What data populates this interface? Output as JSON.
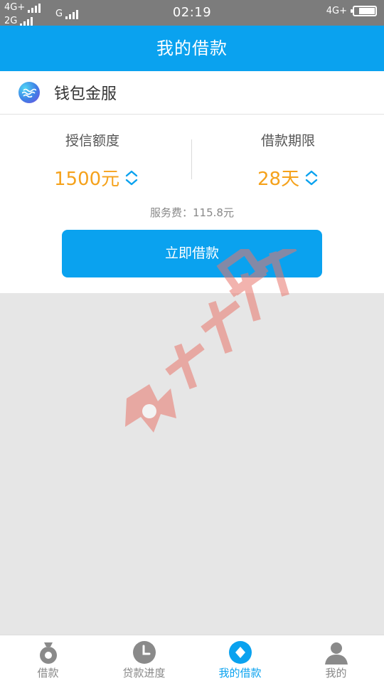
{
  "status_bar": {
    "sim1_type": "4G+",
    "sim2_type": "2G",
    "sim2_carrier": "G",
    "time": "02:19",
    "network_right": "4G+"
  },
  "header": {
    "title": "我的借款"
  },
  "provider": {
    "name": "钱包金服",
    "logo_icon": "wave-logo-icon"
  },
  "loan": {
    "credit_label": "授信额度",
    "credit_value": "1500元",
    "term_label": "借款期限",
    "term_value": "28天",
    "fee_text": "服务费：115.8元",
    "borrow_button": "立即借款"
  },
  "tabs": [
    {
      "label": "借款",
      "icon": "money-bag-icon",
      "active": false
    },
    {
      "label": "贷款进度",
      "icon": "clock-icon",
      "active": false
    },
    {
      "label": "我的借款",
      "icon": "diamond-icon",
      "active": true
    },
    {
      "label": "我的",
      "icon": "user-icon",
      "active": false
    }
  ],
  "colors": {
    "primary": "#0aa2ef",
    "accent": "#f5a21c",
    "status_bar": "#7c7c7c",
    "background": "#e6e6e6",
    "watermark": "#e8766c"
  }
}
